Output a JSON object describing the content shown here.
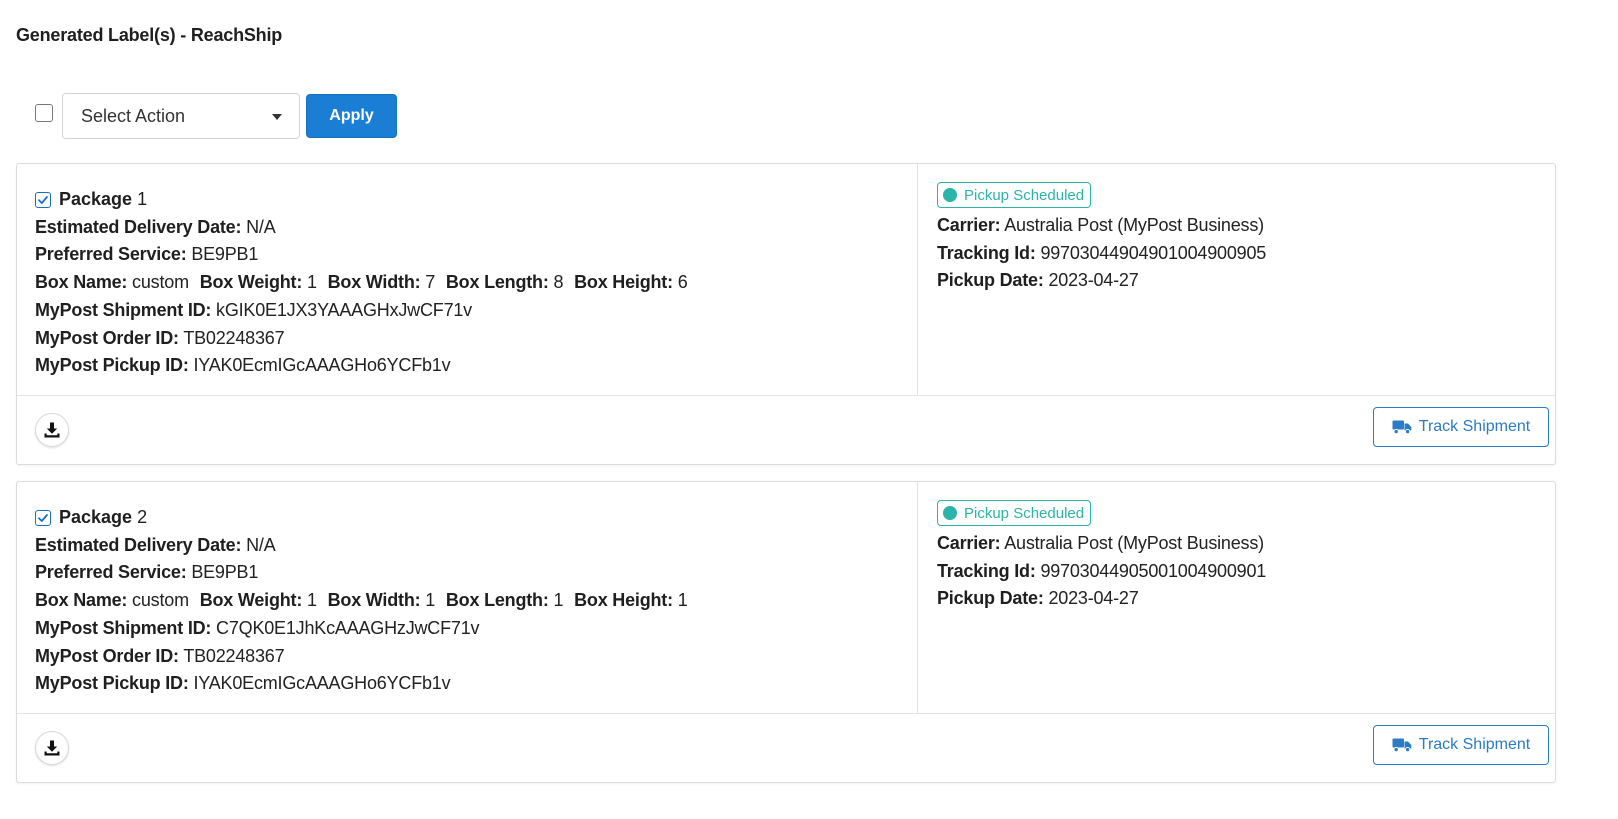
{
  "page": {
    "title": "Generated Label(s) - ReachShip"
  },
  "toolbar": {
    "select_label": "Select Action",
    "apply_label": "Apply"
  },
  "colors": {
    "primary": "#1a7fd4",
    "status": "#2bb4a7",
    "border": "#dcdcdc"
  },
  "labels": {
    "estimated_delivery": "Estimated Delivery Date:",
    "preferred_service": "Preferred Service:",
    "box_name": "Box Name:",
    "box_weight": "Box Weight:",
    "box_width": "Box Width:",
    "box_length": "Box Length:",
    "box_height": "Box Height:",
    "shipment_id": "MyPost Shipment ID:",
    "order_id": "MyPost Order ID:",
    "pickup_id": "MyPost Pickup ID:",
    "carrier": "Carrier:",
    "tracking_id": "Tracking Id:",
    "pickup_date": "Pickup Date:",
    "track_shipment": "Track Shipment"
  },
  "packages": [
    {
      "title": "Package",
      "number": "1",
      "checked": true,
      "estimated_delivery": "N/A",
      "preferred_service": "BE9PB1",
      "box_name": "custom",
      "box_weight": "1",
      "box_width": "7",
      "box_length": "8",
      "box_height": "6",
      "shipment_id": "kGIK0E1JX3YAAAGHxJwCF71v",
      "order_id": "TB02248367",
      "pickup_id": "IYAK0EcmIGcAAAGHo6YCFb1v",
      "status": "Pickup Scheduled",
      "carrier": "Australia Post (MyPost Business)",
      "tracking_id": "99703044904901004900905",
      "pickup_date": "2023-04-27"
    },
    {
      "title": "Package",
      "number": "2",
      "checked": true,
      "estimated_delivery": "N/A",
      "preferred_service": "BE9PB1",
      "box_name": "custom",
      "box_weight": "1",
      "box_width": "1",
      "box_length": "1",
      "box_height": "1",
      "shipment_id": "C7QK0E1JhKcAAAGHzJwCF71v",
      "order_id": "TB02248367",
      "pickup_id": "IYAK0EcmIGcAAAGHo6YCFb1v",
      "status": "Pickup Scheduled",
      "carrier": "Australia Post (MyPost Business)",
      "tracking_id": "99703044905001004900901",
      "pickup_date": "2023-04-27"
    }
  ]
}
